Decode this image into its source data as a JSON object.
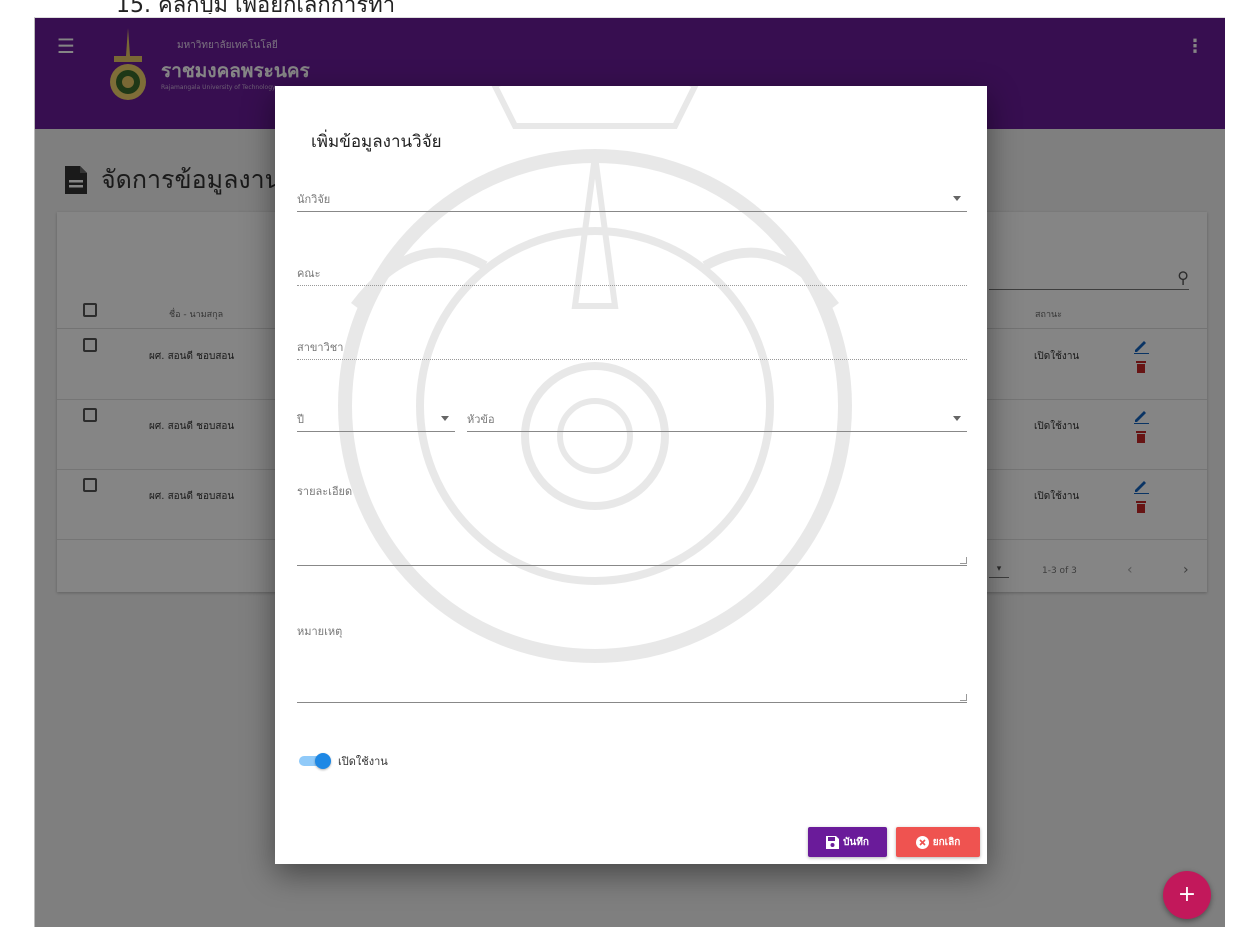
{
  "doc_caption": "15. คลิกปุ่ม  เพื่อยกเลิกการทำ",
  "appbar": {
    "uni_small": "มหาวิทยาลัยเทคโนโลยี",
    "uni_big": "ราชมงคลพระนคร",
    "uni_eng": "Rajamangala University of Technology",
    "color": "#6a1b9a"
  },
  "page": {
    "title": "จัดการข้อมูลงานวิจัย"
  },
  "table": {
    "columns": {
      "name": "ชื่อ - นามสกุล",
      "status": "สถานะ"
    },
    "rows": [
      {
        "name": "ผศ. สอนดี ชอบสอน",
        "status": "เปิดใช้งาน"
      },
      {
        "name": "ผศ. สอนดี ชอบสอน",
        "status": "เปิดใช้งาน"
      },
      {
        "name": "ผศ. สอนดี ชอบสอน",
        "status": "เปิดใช้งาน"
      }
    ],
    "pagination": {
      "range": "1-3 of 3"
    }
  },
  "dialog": {
    "title": "เพิ่มข้อมูลงานวิจัย",
    "fields": {
      "researcher": "นักวิจัย",
      "faculty": "คณะ",
      "department": "สาขาวิชา",
      "year": "ปี",
      "topic": "หัวข้อ",
      "details": "รายละเอียด",
      "note": "หมายเหตุ"
    },
    "toggle_label": "เปิดใช้งาน",
    "toggle_on": true,
    "save_label": "บันทึก",
    "cancel_label": "ยกเลิก"
  },
  "fab_label": "+"
}
